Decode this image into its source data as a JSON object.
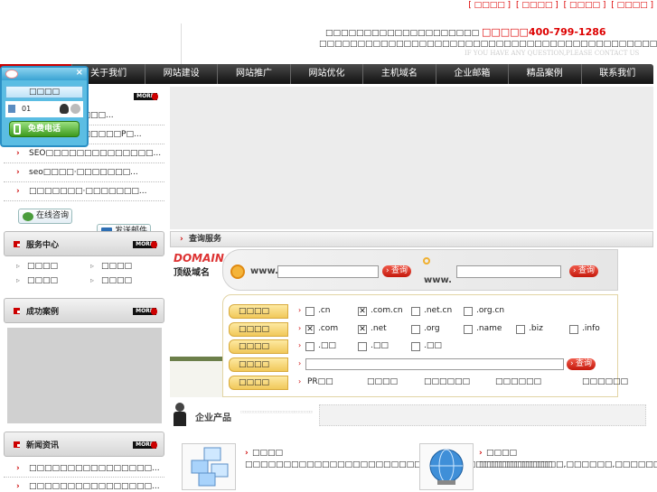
{
  "header": {
    "top_links": [
      "[ □□□□ ]",
      "[ □□□□ ]",
      "[ □□□□ ]",
      "[ □□□□ ]"
    ],
    "hotline_text": "□□□□□□□□□□□□□□□□□□□□",
    "hotline_label": "□□□□□",
    "hotline_number": "400-799-1286",
    "slogan": "□□□□□□□□□□□□□□□□□□□□□□□□□□□□□□□□□□□□□□□□□□□□□□□□□□",
    "english_tagline": "IF YOU HAVE ANY QUESTION,PLEASE CONTACT US"
  },
  "nav": {
    "items": [
      "",
      "关于我们",
      "网站建设",
      "网站推广",
      "网站优化",
      "主机域名",
      "企业邮箱",
      "精品案例",
      "联系我们"
    ]
  },
  "qq_panel": {
    "label": "□□□□",
    "contact_id": "01",
    "call_label": "免费电话"
  },
  "news_top": {
    "more": "MORE",
    "items": [
      "□□□□□□□□□□...",
      "□□□□□□□□□□□□P□...",
      "SEO□□□□□□□□□□□□□□...",
      "seo□□□□·□□□□□□□...",
      "□□□□□□□·□□□□□□□..."
    ]
  },
  "contact_buttons": {
    "online": "在线咨询",
    "email": "发送邮件"
  },
  "service": {
    "title": "服务中心",
    "more": "MORE",
    "items": [
      "□□□□",
      "□□□□",
      "□□□□",
      "□□□□"
    ]
  },
  "cases": {
    "title": "成功案例",
    "more": "MORE"
  },
  "news": {
    "title": "新闻资讯",
    "more": "MORE",
    "items": [
      "□□□□□□□□□□□□□□□□...",
      "□□□□□□□□□□□□□□□□..."
    ]
  },
  "query": {
    "header": "查询服务",
    "logo_line1": "DOMAIN",
    "logo_line2": "顶级域名",
    "www1": "www.",
    "www2": "www.",
    "button": "查询",
    "rows": [
      {
        "label": "□□□□",
        "options": [
          {
            "text": ".cn",
            "checked": false
          },
          {
            "text": ".com.cn",
            "checked": true
          },
          {
            "text": ".net.cn",
            "checked": false
          },
          {
            "text": ".org.cn",
            "checked": false
          }
        ]
      },
      {
        "label": "□□□□",
        "options": [
          {
            "text": ".com",
            "checked": true
          },
          {
            "text": ".net",
            "checked": true
          },
          {
            "text": ".org",
            "checked": false
          },
          {
            "text": ".name",
            "checked": false
          },
          {
            "text": ".biz",
            "checked": false
          },
          {
            "text": ".info",
            "checked": false
          }
        ]
      },
      {
        "label": "□□□□",
        "options": [
          {
            "text": ".□□",
            "checked": false
          },
          {
            "text": ".□□",
            "checked": false
          },
          {
            "text": ".□□",
            "checked": false
          }
        ]
      },
      {
        "label": "□□□□"
      },
      {
        "label": "□□□□",
        "links": [
          "PR□□",
          "□□□□",
          "□□□□□□",
          "□□□□□□",
          "□□□□□□"
        ]
      }
    ]
  },
  "products": {
    "title": "企业产品",
    "tiny_text": "□□□□□□□□□□□□□□□□□□□□□□□□□□□□□□□□□□□□□□□□□□□□□□□□□□□□□□□□",
    "cards": [
      {
        "title": "□□□□",
        "desc": "□□□□□□□□□□□□□□□□□□□□□□□□□□□□□□□□□□□□□□□□"
      },
      {
        "title": "□□□□",
        "desc": "□□□□□□□□□□□,□□□□□□,□□□□□□□,□□□□□□□□□□□□□□□□"
      }
    ]
  },
  "colors": {
    "brand_red": "#cc0000",
    "nav_dark": "#222222",
    "qq_blue": "#5bbde3"
  }
}
